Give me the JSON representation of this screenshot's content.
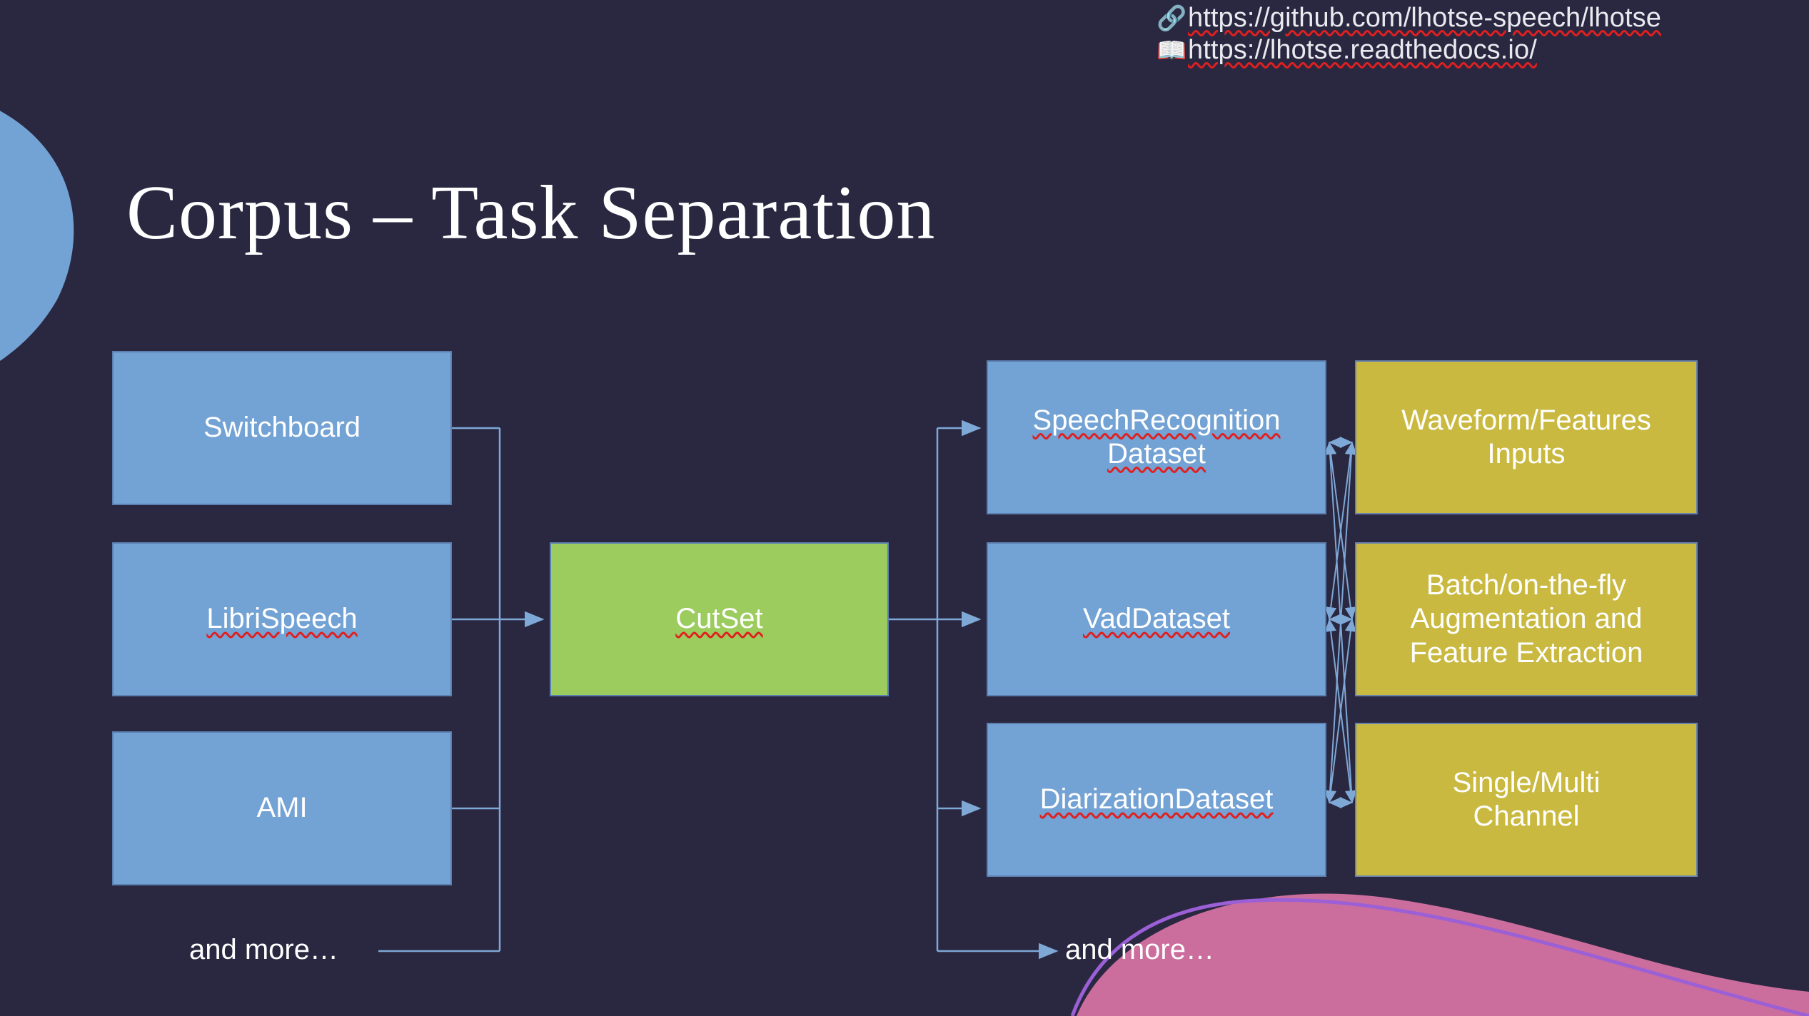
{
  "slide": {
    "title": "Corpus – Task Separation",
    "background_color": "#2a2740"
  },
  "links": [
    {
      "icon": "link-icon",
      "glyph": "🔗",
      "url": "https://github.com/lhotse-speech/lhotse"
    },
    {
      "icon": "book-icon",
      "glyph": "📖",
      "url": "https://lhotse.readthedocs.io/"
    }
  ],
  "diagram": {
    "corpora": [
      {
        "label": "Switchboard",
        "color": "#73a2d4"
      },
      {
        "label": "LibriSpeech",
        "color": "#73a2d4"
      },
      {
        "label": "AMI",
        "color": "#73a2d4"
      }
    ],
    "corpora_more_label": "and more…",
    "cutset": {
      "label": "CutSet",
      "color": "#9ccb5e"
    },
    "datasets": [
      {
        "label_lines": [
          "SpeechRecognition",
          "Dataset"
        ],
        "color": "#73a2d4"
      },
      {
        "label_lines": [
          "VadDataset"
        ],
        "color": "#73a2d4"
      },
      {
        "label_lines": [
          "DiarizationDataset"
        ],
        "color": "#73a2d4"
      }
    ],
    "datasets_more_label": "and more…",
    "capabilities": [
      {
        "label_lines": [
          "Waveform/Features",
          "Inputs"
        ],
        "color": "#c9b941"
      },
      {
        "label_lines": [
          "Batch/on-the-fly",
          "Augmentation and",
          "Feature Extraction"
        ],
        "color": "#c9b941"
      },
      {
        "label_lines": [
          "Single/Multi",
          "Channel"
        ],
        "color": "#c9b941"
      }
    ]
  },
  "decorations": {
    "top_left_blob_color": "#73a2d4",
    "bottom_right_blob_color": "#cb6e9d",
    "curve_color": "#9b5fd6"
  },
  "text_labels": {
    "switchboard": "Switchboard",
    "librispeech": "LibriSpeech",
    "ami": "AMI",
    "cutset": "CutSet",
    "more_left": "and more…",
    "more_right": "and more…",
    "sr_line1": "SpeechRecognition",
    "sr_line2": "Dataset",
    "vad": "VadDataset",
    "diar": "DiarizationDataset",
    "wf_line1": "Waveform/Features",
    "wf_line2": "Inputs",
    "aug_line1": "Batch/on-the-fly",
    "aug_line2": "Augmentation and",
    "aug_line3": "Feature Extraction",
    "chan_line1": "Single/Multi",
    "chan_line2": "Channel"
  }
}
